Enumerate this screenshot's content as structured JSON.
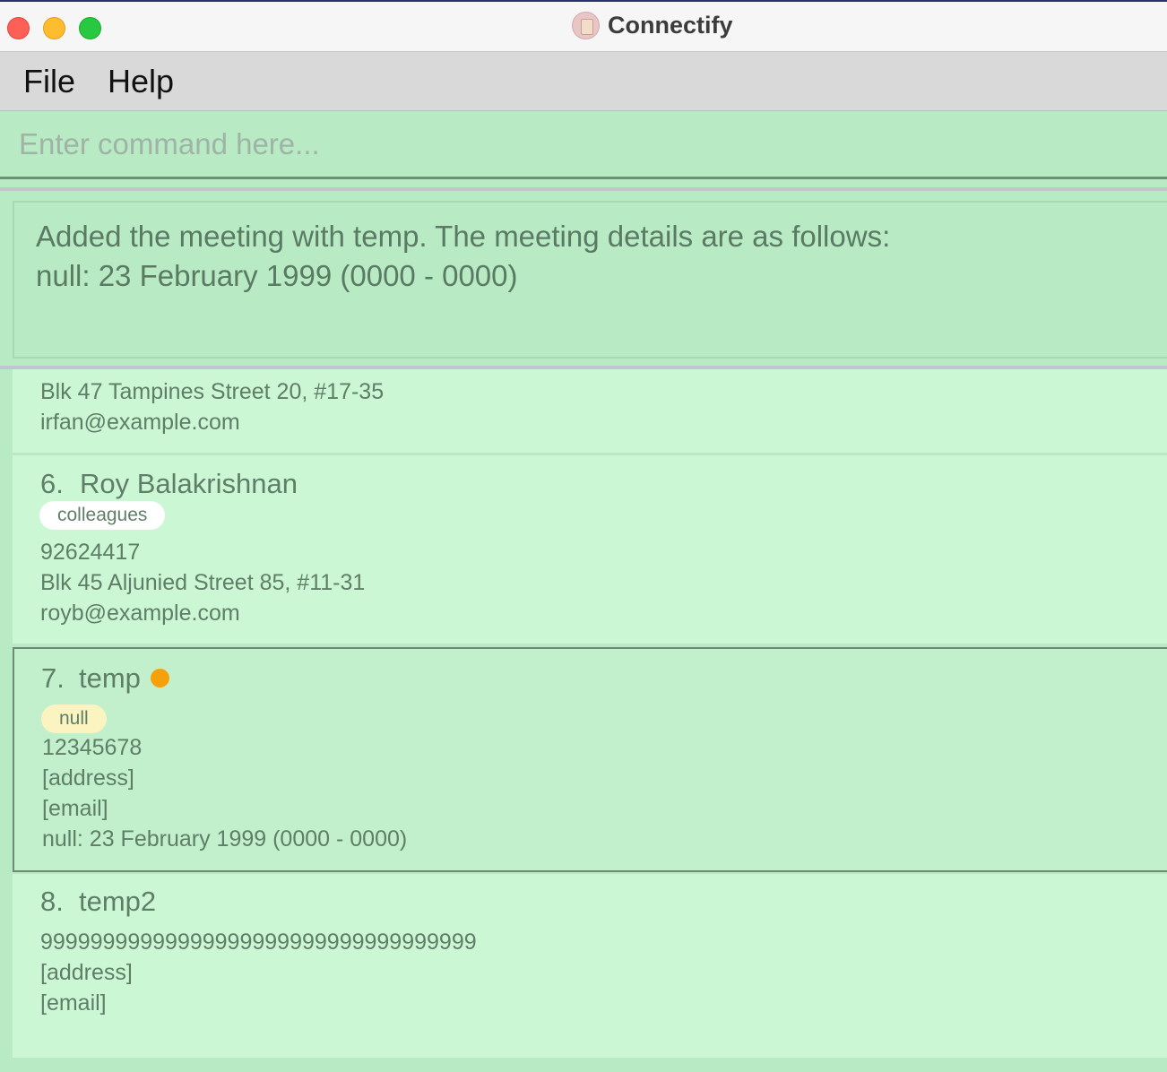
{
  "window": {
    "title": "Connectify",
    "controls": {
      "close": "close",
      "minimize": "minimize",
      "maximize": "maximize"
    }
  },
  "menu": {
    "file": "File",
    "help": "Help"
  },
  "command": {
    "placeholder": "Enter command here...",
    "value": ""
  },
  "result": {
    "line1": "Added the meeting with temp. The meeting details are as follows:",
    "line2": "null: 23 February 1999 (0000 - 0000)"
  },
  "contacts": [
    {
      "partial": true,
      "address": "Blk 47 Tampines Street 20, #17-35",
      "email": "irfan@example.com"
    },
    {
      "index": "6.",
      "name": "Roy Balakrishnan",
      "tag": "colleagues",
      "phone": "92624417",
      "address": "Blk 45 Aljunied Street 85, #11-31",
      "email": "royb@example.com"
    },
    {
      "index": "7.",
      "name": "temp",
      "status_color": "#f7a10a",
      "tag": "null",
      "phone": "12345678",
      "address": "[address]",
      "email": "[email]",
      "meeting": "null: 23 February 1999 (0000 - 0000)",
      "selected": true
    },
    {
      "index": "8.",
      "name": "temp2",
      "phone": "99999999999999999999999999999999999",
      "address": "[address]",
      "email": "[email]"
    }
  ],
  "colors": {
    "background": "#b8eac4",
    "card": "#ccf7d5",
    "text": "#5f7e68",
    "status_dot": "#f7a10a"
  }
}
